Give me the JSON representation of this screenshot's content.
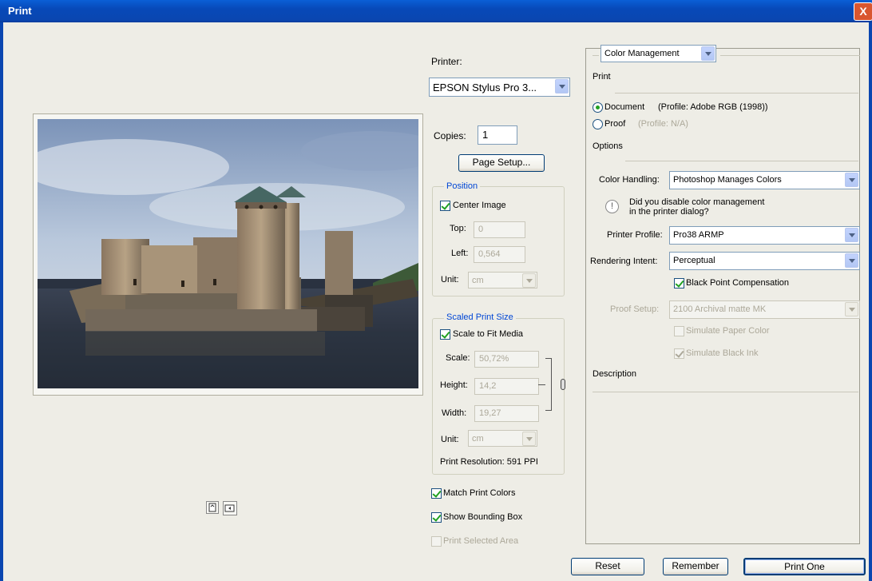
{
  "window": {
    "title": "Print",
    "close_glyph": "X"
  },
  "printer": {
    "label": "Printer:",
    "value": "EPSON Stylus Pro 3..."
  },
  "copies": {
    "label": "Copies:",
    "value": "1"
  },
  "page_setup_label": "Page Setup...",
  "position": {
    "title": "Position",
    "center_image": "Center Image",
    "top_label": "Top:",
    "top_value": "0",
    "left_label": "Left:",
    "left_value": "0,564",
    "unit_label": "Unit:",
    "unit_value": "cm"
  },
  "scaled": {
    "title": "Scaled Print Size",
    "scale_to_fit": "Scale to Fit Media",
    "scale_label": "Scale:",
    "scale_value": "50,72%",
    "height_label": "Height:",
    "height_value": "14,2",
    "width_label": "Width:",
    "width_value": "19,27",
    "unit_label": "Unit:",
    "unit_value": "cm",
    "resolution": "Print Resolution: 591 PPI"
  },
  "options_left": {
    "match_print_colors": "Match Print Colors",
    "show_bounding_box": "Show Bounding Box",
    "print_selected_area": "Print Selected Area"
  },
  "color_mgmt": {
    "dropdown": "Color Management",
    "print_heading": "Print",
    "document_label": "Document",
    "document_profile": "(Profile: Adobe RGB (1998))",
    "proof_label": "Proof",
    "proof_profile": "(Profile: N/A)",
    "options_heading": "Options",
    "color_handling_label": "Color Handling:",
    "color_handling_value": "Photoshop Manages Colors",
    "warning_line1": "Did you disable color management",
    "warning_line2": "in the printer dialog?",
    "printer_profile_label": "Printer Profile:",
    "printer_profile_value": "Pro38 ARMP",
    "rendering_intent_label": "Rendering Intent:",
    "rendering_intent_value": "Perceptual",
    "black_point": "Black Point Compensation",
    "proof_setup_label": "Proof Setup:",
    "proof_setup_value": "2100 Archival matte MK",
    "simulate_paper": "Simulate Paper Color",
    "simulate_black": "Simulate Black Ink",
    "description_heading": "Description"
  },
  "buttons": {
    "reset": "Reset",
    "remember": "Remember",
    "print_one": "Print One"
  },
  "colors": {
    "titlebar": "#0a5fd6",
    "group_title": "#0046d5",
    "background": "#eeede6"
  }
}
